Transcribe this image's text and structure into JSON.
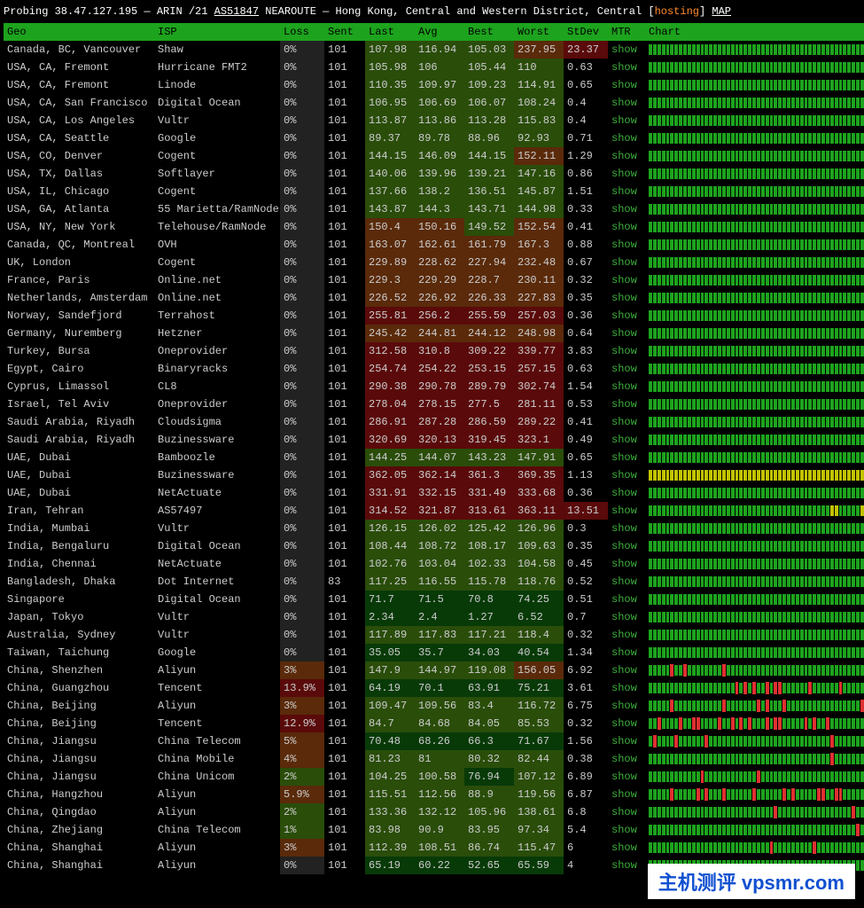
{
  "probe": {
    "prefix": "Probing ",
    "ip": "38.47.127.195",
    "sep": " — ",
    "registry": "ARIN /21 ",
    "asn": "AS51847",
    "route": " NEAROUTE — Hong Kong, Central and Western District, Central [",
    "hosting": "hosting",
    "close": "] ",
    "map": "MAP"
  },
  "headers": {
    "geo": "Geo",
    "isp": "ISP",
    "loss": "Loss",
    "sent": "Sent",
    "last": "Last",
    "avg": "Avg",
    "best": "Best",
    "worst": "Worst",
    "stdev": "StDev",
    "mtr": "MTR",
    "chart": "Chart"
  },
  "mtr_label": "show",
  "ping_categories": {
    "low": 80,
    "med": 150,
    "high": 250
  },
  "rows": [
    {
      "geo": "Canada, BC, Vancouver",
      "isp": "Shaw",
      "loss": "0%",
      "sent": "101",
      "last": "107.98",
      "avg": "116.94",
      "best": "105.03",
      "worst": "237.95",
      "stdev": "23.37",
      "loss_n": 0,
      "avg_n": 116.94,
      "chart": "ok"
    },
    {
      "geo": "USA, CA, Fremont",
      "isp": "Hurricane FMT2",
      "loss": "0%",
      "sent": "101",
      "last": "105.98",
      "avg": "106",
      "best": "105.44",
      "worst": "110",
      "stdev": "0.63",
      "loss_n": 0,
      "avg_n": 106,
      "chart": "ok"
    },
    {
      "geo": "USA, CA, Fremont",
      "isp": "Linode",
      "loss": "0%",
      "sent": "101",
      "last": "110.35",
      "avg": "109.97",
      "best": "109.23",
      "worst": "114.91",
      "stdev": "0.65",
      "loss_n": 0,
      "avg_n": 109.97,
      "chart": "ok"
    },
    {
      "geo": "USA, CA, San Francisco",
      "isp": "Digital Ocean",
      "loss": "0%",
      "sent": "101",
      "last": "106.95",
      "avg": "106.69",
      "best": "106.07",
      "worst": "108.24",
      "stdev": "0.4",
      "loss_n": 0,
      "avg_n": 106.69,
      "chart": "ok"
    },
    {
      "geo": "USA, CA, Los Angeles",
      "isp": "Vultr",
      "loss": "0%",
      "sent": "101",
      "last": "113.87",
      "avg": "113.86",
      "best": "113.28",
      "worst": "115.83",
      "stdev": "0.4",
      "loss_n": 0,
      "avg_n": 113.86,
      "chart": "ok"
    },
    {
      "geo": "USA, CA, Seattle",
      "isp": "Google",
      "loss": "0%",
      "sent": "101",
      "last": "89.37",
      "avg": "89.78",
      "best": "88.96",
      "worst": "92.93",
      "stdev": "0.71",
      "loss_n": 0,
      "avg_n": 89.78,
      "chart": "ok"
    },
    {
      "geo": "USA, CO, Denver",
      "isp": "Cogent",
      "loss": "0%",
      "sent": "101",
      "last": "144.15",
      "avg": "146.09",
      "best": "144.15",
      "worst": "152.11",
      "stdev": "1.29",
      "loss_n": 0,
      "avg_n": 146.09,
      "chart": "ok"
    },
    {
      "geo": "USA, TX, Dallas",
      "isp": "Softlayer",
      "loss": "0%",
      "sent": "101",
      "last": "140.06",
      "avg": "139.96",
      "best": "139.21",
      "worst": "147.16",
      "stdev": "0.86",
      "loss_n": 0,
      "avg_n": 139.96,
      "chart": "ok"
    },
    {
      "geo": "USA, IL, Chicago",
      "isp": "Cogent",
      "loss": "0%",
      "sent": "101",
      "last": "137.66",
      "avg": "138.2",
      "best": "136.51",
      "worst": "145.87",
      "stdev": "1.51",
      "loss_n": 0,
      "avg_n": 138.2,
      "chart": "ok"
    },
    {
      "geo": "USA, GA, Atlanta",
      "isp": "55 Marietta/RamNode",
      "loss": "0%",
      "sent": "101",
      "last": "143.87",
      "avg": "144.3",
      "best": "143.71",
      "worst": "144.98",
      "stdev": "0.33",
      "loss_n": 0,
      "avg_n": 144.3,
      "chart": "ok"
    },
    {
      "geo": "USA, NY, New York",
      "isp": "Telehouse/RamNode",
      "loss": "0%",
      "sent": "101",
      "last": "150.4",
      "avg": "150.16",
      "best": "149.52",
      "worst": "152.54",
      "stdev": "0.41",
      "loss_n": 0,
      "avg_n": 150.16,
      "chart": "ok"
    },
    {
      "geo": "Canada, QC, Montreal",
      "isp": "OVH",
      "loss": "0%",
      "sent": "101",
      "last": "163.07",
      "avg": "162.61",
      "best": "161.79",
      "worst": "167.3",
      "stdev": "0.88",
      "loss_n": 0,
      "avg_n": 162.61,
      "chart": "ok"
    },
    {
      "geo": "UK, London",
      "isp": "Cogent",
      "loss": "0%",
      "sent": "101",
      "last": "229.89",
      "avg": "228.62",
      "best": "227.94",
      "worst": "232.48",
      "stdev": "0.67",
      "loss_n": 0,
      "avg_n": 228.62,
      "chart": "ok"
    },
    {
      "geo": "France, Paris",
      "isp": "Online.net",
      "loss": "0%",
      "sent": "101",
      "last": "229.3",
      "avg": "229.29",
      "best": "228.7",
      "worst": "230.11",
      "stdev": "0.32",
      "loss_n": 0,
      "avg_n": 229.29,
      "chart": "ok"
    },
    {
      "geo": "Netherlands, Amsterdam",
      "isp": "Online.net",
      "loss": "0%",
      "sent": "101",
      "last": "226.52",
      "avg": "226.92",
      "best": "226.33",
      "worst": "227.83",
      "stdev": "0.35",
      "loss_n": 0,
      "avg_n": 226.92,
      "chart": "ok"
    },
    {
      "geo": "Norway, Sandefjord",
      "isp": "Terrahost",
      "loss": "0%",
      "sent": "101",
      "last": "255.81",
      "avg": "256.2",
      "best": "255.59",
      "worst": "257.03",
      "stdev": "0.36",
      "loss_n": 0,
      "avg_n": 256.2,
      "chart": "ok"
    },
    {
      "geo": "Germany, Nuremberg",
      "isp": "Hetzner",
      "loss": "0%",
      "sent": "101",
      "last": "245.42",
      "avg": "244.81",
      "best": "244.12",
      "worst": "248.98",
      "stdev": "0.64",
      "loss_n": 0,
      "avg_n": 244.81,
      "chart": "ok"
    },
    {
      "geo": "Turkey, Bursa",
      "isp": "Oneprovider",
      "loss": "0%",
      "sent": "101",
      "last": "312.58",
      "avg": "310.8",
      "best": "309.22",
      "worst": "339.77",
      "stdev": "3.83",
      "loss_n": 0,
      "avg_n": 310.8,
      "chart": "ok"
    },
    {
      "geo": "Egypt, Cairo",
      "isp": "Binaryracks",
      "loss": "0%",
      "sent": "101",
      "last": "254.74",
      "avg": "254.22",
      "best": "253.15",
      "worst": "257.15",
      "stdev": "0.63",
      "loss_n": 0,
      "avg_n": 254.22,
      "chart": "ok"
    },
    {
      "geo": "Cyprus, Limassol",
      "isp": "CL8",
      "loss": "0%",
      "sent": "101",
      "last": "290.38",
      "avg": "290.78",
      "best": "289.79",
      "worst": "302.74",
      "stdev": "1.54",
      "loss_n": 0,
      "avg_n": 290.78,
      "chart": "ok"
    },
    {
      "geo": "Israel, Tel Aviv",
      "isp": "Oneprovider",
      "loss": "0%",
      "sent": "101",
      "last": "278.04",
      "avg": "278.15",
      "best": "277.5",
      "worst": "281.11",
      "stdev": "0.53",
      "loss_n": 0,
      "avg_n": 278.15,
      "chart": "ok"
    },
    {
      "geo": "Saudi Arabia, Riyadh",
      "isp": "Cloudsigma",
      "loss": "0%",
      "sent": "101",
      "last": "286.91",
      "avg": "287.28",
      "best": "286.59",
      "worst": "289.22",
      "stdev": "0.41",
      "loss_n": 0,
      "avg_n": 287.28,
      "chart": "ok"
    },
    {
      "geo": "Saudi Arabia, Riyadh",
      "isp": "Buzinessware",
      "loss": "0%",
      "sent": "101",
      "last": "320.69",
      "avg": "320.13",
      "best": "319.45",
      "worst": "323.1",
      "stdev": "0.49",
      "loss_n": 0,
      "avg_n": 320.13,
      "chart": "ok"
    },
    {
      "geo": "UAE, Dubai",
      "isp": "Bamboozle",
      "loss": "0%",
      "sent": "101",
      "last": "144.25",
      "avg": "144.07",
      "best": "143.23",
      "worst": "147.91",
      "stdev": "0.65",
      "loss_n": 0,
      "avg_n": 144.07,
      "chart": "ok"
    },
    {
      "geo": "UAE, Dubai",
      "isp": "Buzinessware",
      "loss": "0%",
      "sent": "101",
      "last": "362.05",
      "avg": "362.14",
      "best": "361.3",
      "worst": "369.35",
      "stdev": "1.13",
      "loss_n": 0,
      "avg_n": 362.14,
      "chart": "high"
    },
    {
      "geo": "UAE, Dubai",
      "isp": "NetActuate",
      "loss": "0%",
      "sent": "101",
      "last": "331.91",
      "avg": "332.15",
      "best": "331.49",
      "worst": "333.68",
      "stdev": "0.36",
      "loss_n": 0,
      "avg_n": 332.15,
      "chart": "ok"
    },
    {
      "geo": "Iran, Tehran",
      "isp": "AS57497",
      "loss": "0%",
      "sent": "101",
      "last": "314.52",
      "avg": "321.87",
      "best": "313.61",
      "worst": "363.11",
      "stdev": "13.51",
      "loss_n": 0,
      "avg_n": 321.87,
      "chart": "spike"
    },
    {
      "geo": "India, Mumbai",
      "isp": "Vultr",
      "loss": "0%",
      "sent": "101",
      "last": "126.15",
      "avg": "126.02",
      "best": "125.42",
      "worst": "126.96",
      "stdev": "0.3",
      "loss_n": 0,
      "avg_n": 126.02,
      "chart": "ok"
    },
    {
      "geo": "India, Bengaluru",
      "isp": "Digital Ocean",
      "loss": "0%",
      "sent": "101",
      "last": "108.44",
      "avg": "108.72",
      "best": "108.17",
      "worst": "109.63",
      "stdev": "0.35",
      "loss_n": 0,
      "avg_n": 108.72,
      "chart": "ok"
    },
    {
      "geo": "India, Chennai",
      "isp": "NetActuate",
      "loss": "0%",
      "sent": "101",
      "last": "102.76",
      "avg": "103.04",
      "best": "102.33",
      "worst": "104.58",
      "stdev": "0.45",
      "loss_n": 0,
      "avg_n": 103.04,
      "chart": "ok"
    },
    {
      "geo": "Bangladesh, Dhaka",
      "isp": "Dot Internet",
      "loss": "0%",
      "sent": "83",
      "last": "117.25",
      "avg": "116.55",
      "best": "115.78",
      "worst": "118.76",
      "stdev": "0.52",
      "loss_n": 0,
      "avg_n": 116.55,
      "chart": "ok"
    },
    {
      "geo": "Singapore",
      "isp": "Digital Ocean",
      "loss": "0%",
      "sent": "101",
      "last": "71.7",
      "avg": "71.5",
      "best": "70.8",
      "worst": "74.25",
      "stdev": "0.51",
      "loss_n": 0,
      "avg_n": 71.5,
      "chart": "ok"
    },
    {
      "geo": "Japan, Tokyo",
      "isp": "Vultr",
      "loss": "0%",
      "sent": "101",
      "last": "2.34",
      "avg": "2.4",
      "best": "1.27",
      "worst": "6.52",
      "stdev": "0.7",
      "loss_n": 0,
      "avg_n": 2.4,
      "chart": "ok"
    },
    {
      "geo": "Australia, Sydney",
      "isp": "Vultr",
      "loss": "0%",
      "sent": "101",
      "last": "117.89",
      "avg": "117.83",
      "best": "117.21",
      "worst": "118.4",
      "stdev": "0.32",
      "loss_n": 0,
      "avg_n": 117.83,
      "chart": "ok"
    },
    {
      "geo": "Taiwan, Taichung",
      "isp": "Google",
      "loss": "0%",
      "sent": "101",
      "last": "35.05",
      "avg": "35.7",
      "best": "34.03",
      "worst": "40.54",
      "stdev": "1.34",
      "loss_n": 0,
      "avg_n": 35.7,
      "chart": "ok"
    },
    {
      "geo": "China, Shenzhen",
      "isp": "Aliyun",
      "loss": "3%",
      "sent": "101",
      "last": "147.9",
      "avg": "144.97",
      "best": "119.08",
      "worst": "156.05",
      "stdev": "6.92",
      "loss_n": 3,
      "avg_n": 144.97,
      "chart": "loss-sparse"
    },
    {
      "geo": "China, Guangzhou",
      "isp": "Tencent",
      "loss": "13.9%",
      "sent": "101",
      "last": "64.19",
      "avg": "70.1",
      "best": "63.91",
      "worst": "75.21",
      "stdev": "3.61",
      "loss_n": 13.9,
      "avg_n": 70.1,
      "chart": "loss-heavy"
    },
    {
      "geo": "China, Beijing",
      "isp": "Aliyun",
      "loss": "3%",
      "sent": "101",
      "last": "109.47",
      "avg": "109.56",
      "best": "83.4",
      "worst": "116.72",
      "stdev": "6.75",
      "loss_n": 3,
      "avg_n": 109.56,
      "chart": "loss-sparse"
    },
    {
      "geo": "China, Beijing",
      "isp": "Tencent",
      "loss": "12.9%",
      "sent": "101",
      "last": "84.7",
      "avg": "84.68",
      "best": "84.05",
      "worst": "85.53",
      "stdev": "0.32",
      "loss_n": 12.9,
      "avg_n": 84.68,
      "chart": "loss-heavy"
    },
    {
      "geo": "China, Jiangsu",
      "isp": "China Telecom",
      "loss": "5%",
      "sent": "101",
      "last": "70.48",
      "avg": "68.26",
      "best": "66.3",
      "worst": "71.67",
      "stdev": "1.56",
      "loss_n": 5,
      "avg_n": 68.26,
      "chart": "loss-sparse"
    },
    {
      "geo": "China, Jiangsu",
      "isp": "China Mobile",
      "loss": "4%",
      "sent": "101",
      "last": "81.23",
      "avg": "81",
      "best": "80.32",
      "worst": "82.44",
      "stdev": "0.38",
      "loss_n": 4,
      "avg_n": 81,
      "chart": "loss-sparse"
    },
    {
      "geo": "China, Jiangsu",
      "isp": "China Unicom",
      "loss": "2%",
      "sent": "101",
      "last": "104.25",
      "avg": "100.58",
      "best": "76.94",
      "worst": "107.12",
      "stdev": "6.89",
      "loss_n": 2,
      "avg_n": 100.58,
      "chart": "loss-sparse"
    },
    {
      "geo": "China, Hangzhou",
      "isp": "Aliyun",
      "loss": "5.9%",
      "sent": "101",
      "last": "115.51",
      "avg": "112.56",
      "best": "88.9",
      "worst": "119.56",
      "stdev": "6.87",
      "loss_n": 5.9,
      "avg_n": 112.56,
      "chart": "loss-sparse"
    },
    {
      "geo": "China, Qingdao",
      "isp": "Aliyun",
      "loss": "2%",
      "sent": "101",
      "last": "133.36",
      "avg": "132.12",
      "best": "105.96",
      "worst": "138.61",
      "stdev": "6.8",
      "loss_n": 2,
      "avg_n": 132.12,
      "chart": "loss-sparse"
    },
    {
      "geo": "China, Zhejiang",
      "isp": "China Telecom",
      "loss": "1%",
      "sent": "101",
      "last": "83.98",
      "avg": "90.9",
      "best": "83.95",
      "worst": "97.34",
      "stdev": "5.4",
      "loss_n": 1,
      "avg_n": 90.9,
      "chart": "loss-sparse"
    },
    {
      "geo": "China, Shanghai",
      "isp": "Aliyun",
      "loss": "3%",
      "sent": "101",
      "last": "112.39",
      "avg": "108.51",
      "best": "86.74",
      "worst": "115.47",
      "stdev": "6",
      "loss_n": 3,
      "avg_n": 108.51,
      "chart": "loss-sparse"
    },
    {
      "geo": "China, Shanghai",
      "isp": "Aliyun",
      "loss": "0%",
      "sent": "101",
      "last": "65.19",
      "avg": "60.22",
      "best": "52.65",
      "worst": "65.59",
      "stdev": "4",
      "loss_n": 0,
      "avg_n": 60.22,
      "chart": "ok"
    }
  ],
  "watermark": "主机测评 vpsmr.com"
}
